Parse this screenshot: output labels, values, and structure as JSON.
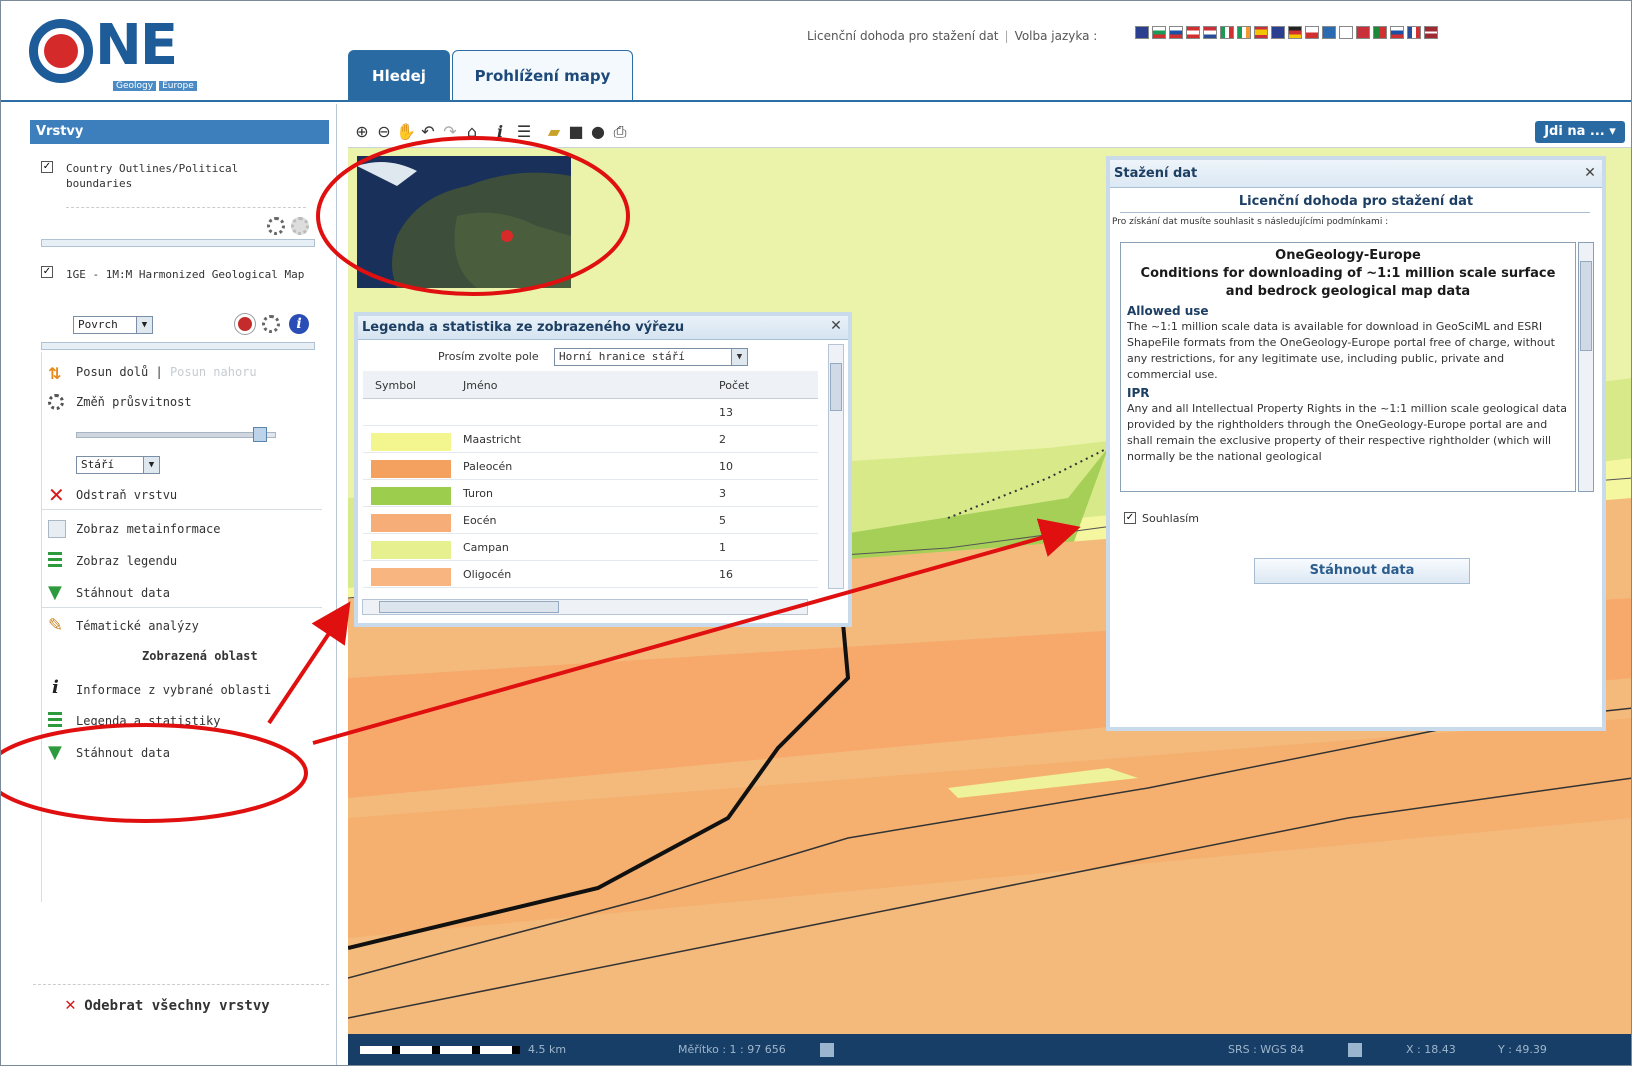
{
  "header": {
    "logo_text": "NE",
    "logo_sub": [
      "Geology",
      "Europe"
    ],
    "tabs": [
      {
        "label": "Hledej"
      },
      {
        "label": "Prohlížení mapy"
      }
    ],
    "license_link": "Licenční dohoda pro stažení dat",
    "language_label": "Volba jazyka :"
  },
  "sidebar": {
    "title": "Vrstvy",
    "layers": [
      {
        "label": "Country Outlines/Political boundaries",
        "checked": true
      },
      {
        "label": "1GE - 1M:M Harmonized Geological Map",
        "checked": true
      }
    ],
    "surface_select": "Povrch",
    "move_down": "Posun dolů",
    "move_sep": "|",
    "move_up": "Posun nahoru",
    "opacity": "Změň průsvitnost",
    "opacity_value": 0.95,
    "age_select": "Stáří",
    "remove_layer": "Odstraň vrstvu",
    "metainfo": "Zobraz metainformace",
    "legend": "Zobraz legendu",
    "download": "Stáhnout data",
    "thematic": "Tématické analýzy",
    "visible_area": "Zobrazená oblast",
    "info_area": "Informace z vybrané oblasti",
    "legend_stats": "Legenda a statistiky",
    "download2": "Stáhnout data",
    "remove_all": "Odebrat všechny vrstvy"
  },
  "map": {
    "goto_label": "Jdi na ...",
    "scale_text": "4.5 km",
    "scale_ratio": "Měřítko : 1 : 97 656",
    "srs": "SRS : WGS 84",
    "x_label": "X : 18.43",
    "y_label": "Y : 49.39"
  },
  "legend_window": {
    "title": "Legenda a statistika ze zobrazeného výřezu",
    "field_label": "Prosím zvolte pole",
    "field_value": "Horní hranice stáří",
    "columns": [
      "Symbol",
      "Jméno",
      "Počet"
    ],
    "rows": [
      {
        "color": "",
        "name": "",
        "count": "13"
      },
      {
        "color": "#f3f58e",
        "name": "Maastricht",
        "count": "2"
      },
      {
        "color": "#f4a05e",
        "name": "Paleocén",
        "count": "10"
      },
      {
        "color": "#9ccd4c",
        "name": "Turon",
        "count": "3"
      },
      {
        "color": "#f7ad78",
        "name": "Eocén",
        "count": "5"
      },
      {
        "color": "#e6f08e",
        "name": "Campan",
        "count": "1"
      },
      {
        "color": "#f8b57f",
        "name": "Oligocén",
        "count": "16"
      }
    ]
  },
  "download_window": {
    "title": "Stažení dat",
    "heading": "Licenční dohoda pro stažení dat",
    "intro": "Pro získání dat musíte souhlasit s následujícími podmínkami :",
    "c_title": "OneGeology-Europe",
    "c_sub": "Conditions for downloading of ~1:1 million scale surface and bedrock geological map data",
    "allowed_h": "Allowed use",
    "allowed_p": "The ~1:1 million scale data is available for download in GeoSciML and ESRI ShapeFile formats from the OneGeology-Europe portal free of charge, without any restrictions, for any legitimate use, including public, private and commercial use.",
    "ipr_h": "IPR",
    "ipr_p": "Any and all Intellectual Property Rights in the ~1:1 million scale geological data provided by the rightholders through the OneGeology-Europe portal are and shall remain the exclusive property of their respective rightholder (which will normally be the national geological",
    "agree": "Souhlasím",
    "button": "Stáhnout data"
  }
}
